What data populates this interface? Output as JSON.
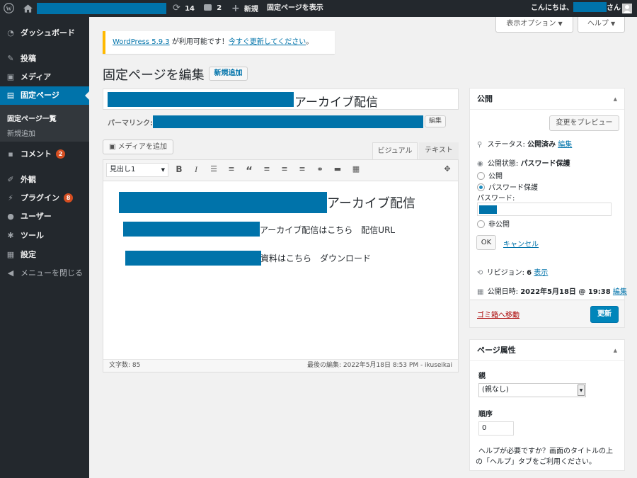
{
  "adminbar": {
    "updates_count": "14",
    "comments_count": "2",
    "new_label": "新規",
    "view_page_label": "固定ページを表示",
    "greeting": "こんにちは、",
    "greeting_suffix": "さん"
  },
  "sidebar": {
    "items": [
      {
        "label": "ダッシュボード",
        "icon": "dashboard-icon"
      },
      {
        "label": "投稿",
        "icon": "pin-icon"
      },
      {
        "label": "メディア",
        "icon": "media-icon"
      },
      {
        "label": "固定ページ",
        "icon": "page-icon"
      },
      {
        "label": "コメント",
        "icon": "comment-icon",
        "badge": "2"
      },
      {
        "label": "外観",
        "icon": "brush-icon"
      },
      {
        "label": "プラグイン",
        "icon": "plugin-icon",
        "badge": "8"
      },
      {
        "label": "ユーザー",
        "icon": "user-icon"
      },
      {
        "label": "ツール",
        "icon": "wrench-icon"
      },
      {
        "label": "設定",
        "icon": "settings-icon"
      },
      {
        "label": "メニューを閉じる",
        "icon": "collapse-icon"
      }
    ],
    "submenu": [
      "固定ページ一覧",
      "新規追加"
    ]
  },
  "screen_options": "表示オプション",
  "help": "ヘルプ",
  "notice": {
    "link1": "WordPress 5.9.3",
    "text": " が利用可能です！",
    "link2": "今すぐ更新してください",
    "end": "。"
  },
  "heading": "固定ページを編集",
  "add_new": "新規追加",
  "title_suffix": "アーカイブ配信",
  "permalink_label": "パーマリンク:",
  "edit_btn": "編集",
  "add_media": "メディアを追加",
  "tabs": {
    "visual": "ビジュアル",
    "text": "テキスト"
  },
  "format_select": "見出し1",
  "content": {
    "heading_suffix": "アーカイブ配信",
    "line1": "アーカイブ配信はこちら　配信URL",
    "line2": "資料はこちら　ダウンロード"
  },
  "status_bar": {
    "word_count": "文字数: 85",
    "last_edited": "最後の編集: 2022年5月18日 8:53 PM - ikuseikai"
  },
  "publish": {
    "title": "公開",
    "preview": "変更をプレビュー",
    "status_label": "ステータス: ",
    "status_value": "公開済み",
    "status_edit": "編集",
    "visibility_label": "公開状態: ",
    "visibility_value": "パスワード保護",
    "opt_public": "公開",
    "opt_password": "パスワード保護",
    "password_label": "パスワード:",
    "opt_private": "非公開",
    "ok": "OK",
    "cancel": "キャンセル",
    "revisions_label": "リビジョン: ",
    "revisions_count": "6",
    "revisions_link": "表示",
    "date_label": "公開日時: ",
    "date_value": "2022年5月18日 @ 19:38",
    "date_edit": "編集",
    "trash": "ゴミ箱へ移動",
    "update": "更新"
  },
  "page_attributes": {
    "title": "ページ属性",
    "parent_label": "親",
    "parent_value": "(親なし)",
    "order_label": "順序",
    "order_value": "0",
    "help_text1": "ヘルプが必要ですか？画面のタイトルの上",
    "help_text2": "の「ヘルプ」タブをご利用ください。"
  }
}
